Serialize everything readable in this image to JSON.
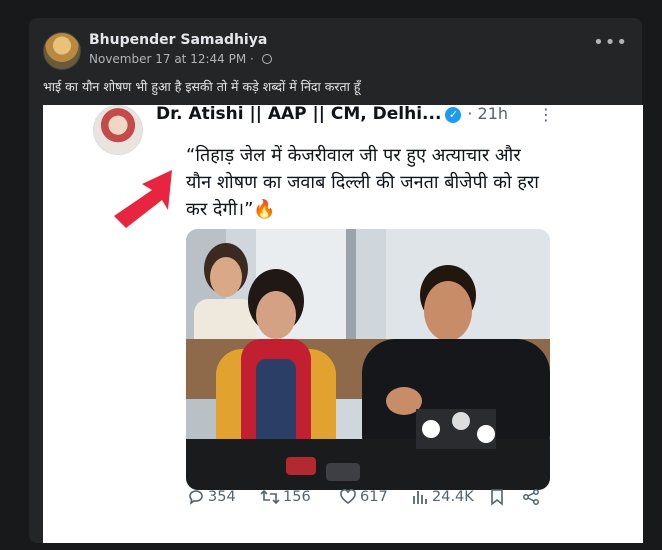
{
  "post": {
    "author": "Bhupender Samadhiya",
    "timestamp": "November 17 at 12:44 PM",
    "separator": "·",
    "more_label": "•••",
    "caption": "भाई का यौन शोषण भी हुआ है इसकी तो में कड़े शब्दों में निंदा करता हूँ"
  },
  "tweet": {
    "name": "Dr. Atishi || AAP || CM, Delhi...",
    "verified_mark": "✓",
    "time": "· 21h",
    "more": "⋮",
    "text_line1": "“तिहाड़ जेल में केजरीवाल जी पर हुए अत्याचार और",
    "text_line2": "यौन शोषण का जवाब दिल्ली की जनता बीजेपी को हरा",
    "text_line3": "कर देगी।”🔥",
    "stats": {
      "replies": "354",
      "retweets": "156",
      "likes": "617",
      "views": "24.4K"
    }
  },
  "colors": {
    "page_bg": "#18191a",
    "post_bg": "#242526",
    "arrow_red": "#e8253f",
    "twitter_blue": "#1d9bf0"
  }
}
